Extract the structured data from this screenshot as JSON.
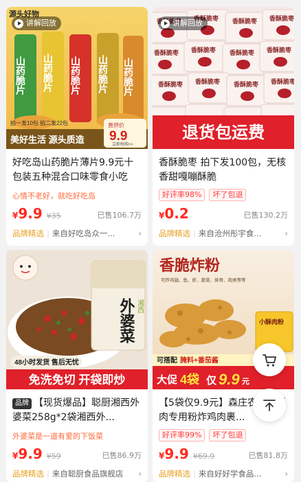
{
  "products": [
    {
      "replay_label": "讲解回放",
      "title": "好吃岛山药脆片薄片9.9元十包装五种混合口味零食小吃",
      "subtitle": "心情不老好，就吃好吃岛",
      "price": "9.9",
      "original_price": "¥35",
      "sold": "已售106.7万",
      "shop_tag": "品牌精选",
      "shop_name": "来自好吃岛众一...",
      "image": {
        "top_left": "源头好物",
        "chip_text": "山药脆片",
        "promo1": "拍一发10包 拍二发22包",
        "banner_left": "美好生活 源头质造",
        "price_label": "直供价",
        "price_value": "9.9",
        "price_btn": "立即抢购>>"
      }
    },
    {
      "replay_label": "讲解回放",
      "title": "香酥脆枣 拍下发100包，无核香甜嘎嘣酥脆",
      "badges": [
        "好评率98%",
        "坏了包退"
      ],
      "price": "0.2",
      "original_price": "",
      "sold": "已售130.2万",
      "shop_tag": "品牌精选",
      "shop_name": "来自沧州彤宇食...",
      "image": {
        "pack_text": "香酥脆枣",
        "banner": "退货包运费"
      }
    },
    {
      "brand_tag": "品牌",
      "title": "【现货爆品】聪厨湘西外婆菜258g*2袋湘西外...",
      "subtitle": "外婆菜是一道有爱的下饭菜",
      "price": "9.9",
      "original_price": "¥59",
      "sold": "已售86.9万",
      "shop_tag": "品牌精选",
      "shop_name": "来自聪厨食品旗舰店",
      "image": {
        "pack_text": "外婆菜",
        "pack_small": "湘西",
        "strip": "48小时发货 售后无忧",
        "banner": "免洗免切 开袋即炒"
      }
    },
    {
      "title": "【5袋仅9.9元】森庄农品小酥肉专用粉炸鸡肉裹...",
      "badges": [
        "好评率99%",
        "坏了包退"
      ],
      "price": "9.9",
      "original_price": "¥69.9",
      "sold": "已售81.8万",
      "shop_tag": "品牌精选",
      "shop_name": "来自好好学食品...",
      "image": {
        "headline": "香脆炸粉",
        "sub_small": "可炸鸡翅、鱼、虾、蔬菜、排骨、肉类等等",
        "mini_text": "小酥肉粉",
        "combo": "可搭配",
        "combo_items": "腌料+番茄酱",
        "deal_prefix": "大促",
        "deal_count": "4袋",
        "deal_price": "9.9",
        "deal_unit": "元"
      }
    }
  ],
  "colors": {
    "price_red": "#ff2a1f",
    "brand_gold": "#e8a023",
    "subtitle_orange": "#ff6a3d"
  },
  "floating": {
    "cart_icon": "cart-icon",
    "top_icon": "back-to-top-icon"
  }
}
